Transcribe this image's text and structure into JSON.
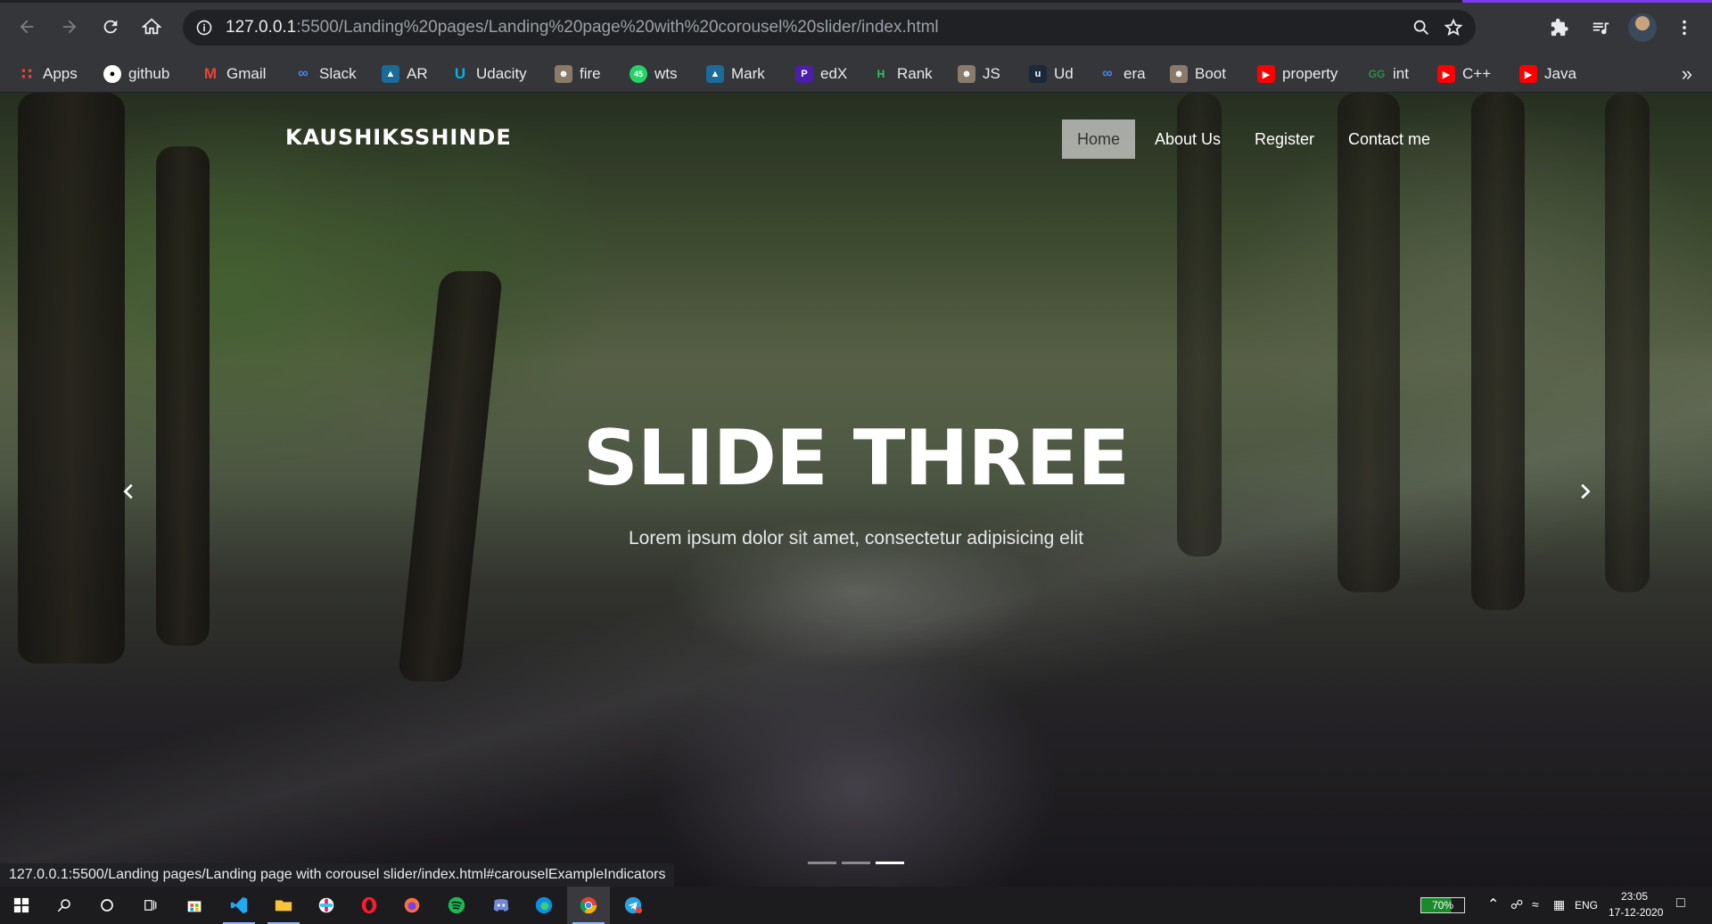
{
  "browser": {
    "url_host": "127.0.0.1",
    "url_path": ":5500/Landing%20pages/Landing%20page%20with%20corousel%20slider/index.html"
  },
  "bookmarks": [
    {
      "label": "Apps",
      "icon": "apps-grid-icon",
      "color": "#ea4335"
    },
    {
      "label": "github",
      "icon": "github-icon",
      "color": "#ffffff"
    },
    {
      "label": "Gmail",
      "icon": "gmail-icon",
      "color": "#ea4335"
    },
    {
      "label": "Slack",
      "icon": "slack-icon",
      "color": "#4285f4"
    },
    {
      "label": "AR",
      "icon": "ar-icon",
      "color": "#1a73e8"
    },
    {
      "label": "Udacity",
      "icon": "udacity-icon",
      "color": "#02b3e4"
    },
    {
      "label": "fire",
      "icon": "avatar-icon",
      "color": "#8a7a6a"
    },
    {
      "label": "wts",
      "icon": "whatsapp-icon",
      "color": "#25d366"
    },
    {
      "label": "Mark",
      "icon": "mark-icon",
      "color": "#1a73e8"
    },
    {
      "label": "edX",
      "icon": "edx-icon",
      "color": "#4b1fa5"
    },
    {
      "label": "Rank",
      "icon": "hackerrank-icon",
      "color": "#2ec866"
    },
    {
      "label": "JS",
      "icon": "avatar-icon",
      "color": "#8a7a6a"
    },
    {
      "label": "Ud",
      "icon": "ud-icon",
      "color": "#1a2a3a"
    },
    {
      "label": "era",
      "icon": "coursera-icon",
      "color": "#4285f4"
    },
    {
      "label": "Boot",
      "icon": "avatar-icon",
      "color": "#8a7a6a"
    },
    {
      "label": "property",
      "icon": "youtube-icon",
      "color": "#ff0000"
    },
    {
      "label": "int",
      "icon": "geeks-icon",
      "color": "#2f8d46"
    },
    {
      "label": "C++",
      "icon": "youtube-icon",
      "color": "#ff0000"
    },
    {
      "label": "Java",
      "icon": "youtube-icon",
      "color": "#ff0000"
    }
  ],
  "site": {
    "brand": "KAUSHIKSSHINDE",
    "nav": [
      "Home",
      "About Us",
      "Register",
      "Contact me"
    ],
    "active_nav": "Home"
  },
  "hero": {
    "title": "SLIDE THREE",
    "subtitle": "Lorem ipsum dolor sit amet, consectetur adipisicing elit",
    "active_slide": 3,
    "slide_count": 3
  },
  "status_bar": "127.0.0.1:5500/Landing pages/Landing page with corousel slider/index.html#carouselExampleIndicators",
  "taskbar": {
    "battery": "70%",
    "language": "ENG",
    "time": "23:05",
    "date": "17-12-2020"
  }
}
